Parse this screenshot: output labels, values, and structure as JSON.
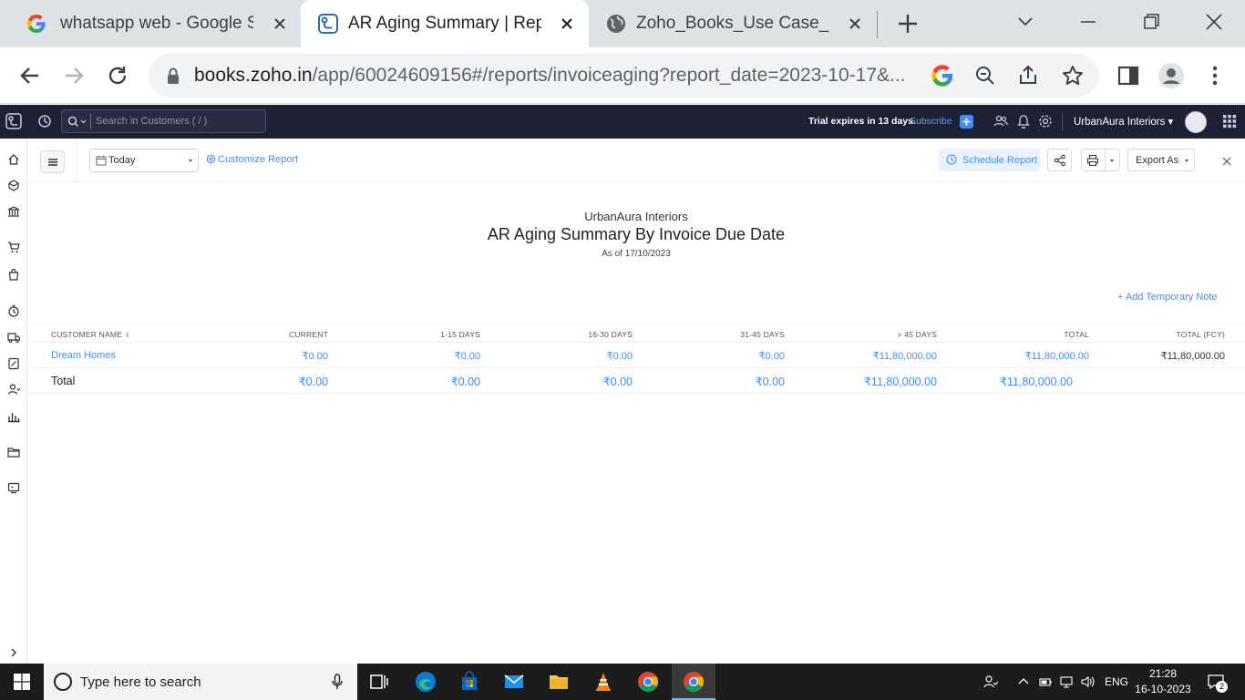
{
  "browser": {
    "tabs": [
      {
        "title": "whatsapp web - Google Se",
        "favicon": "google-g-icon"
      },
      {
        "title": "AR Aging Summary | Repor",
        "favicon": "zoho-books-icon",
        "active": true
      },
      {
        "title": "Zoho_Books_Use Case_Urb",
        "favicon": "globe-icon"
      }
    ],
    "url_host": "books.zoho.in",
    "url_path": "/app/60024609156#/reports/invoiceaging?report_date=2023-10-17&..."
  },
  "zoho": {
    "search_placeholder": "Search in Customers ( / )",
    "trial_text": "Trial expires in 13 days.",
    "subscribe_label": "Subscribe",
    "org_name": "UrbanAura Interiors",
    "colors": {
      "topbar": "#1e2035",
      "accent": "#408dfb"
    }
  },
  "report_toolbar": {
    "date_range": "Today",
    "customize_label": "Customize Report",
    "schedule_label": "Schedule Report",
    "export_label": "Export As"
  },
  "report": {
    "org_name": "UrbanAura Interiors",
    "title": "AR Aging Summary By Invoice Due Date",
    "as_of": "As of 17/10/2023",
    "add_note_label": "+ Add Temporary Note",
    "columns": [
      "CUSTOMER NAME",
      "CURRENT",
      "1-15 DAYS",
      "16-30 DAYS",
      "31-45 DAYS",
      "> 45 DAYS",
      "TOTAL",
      "TOTAL (FCY)"
    ],
    "rows": [
      {
        "customer": "Dream Homes",
        "current": "₹0.00",
        "d1_15": "₹0.00",
        "d16_30": "₹0.00",
        "d31_45": "₹0.00",
        "d45": "₹11,80,000.00",
        "total": "₹11,80,000.00",
        "total_fcy": "₹11,80,000.00"
      }
    ],
    "totals": {
      "label": "Total",
      "current": "₹0.00",
      "d1_15": "₹0.00",
      "d16_30": "₹0.00",
      "d31_45": "₹0.00",
      "d45": "₹11,80,000.00",
      "total": "₹11,80,000.00"
    }
  },
  "taskbar": {
    "search_placeholder": "Type here to search",
    "language": "ENG",
    "time": "21:28",
    "date": "16-10-2023",
    "notification_count": "2"
  }
}
